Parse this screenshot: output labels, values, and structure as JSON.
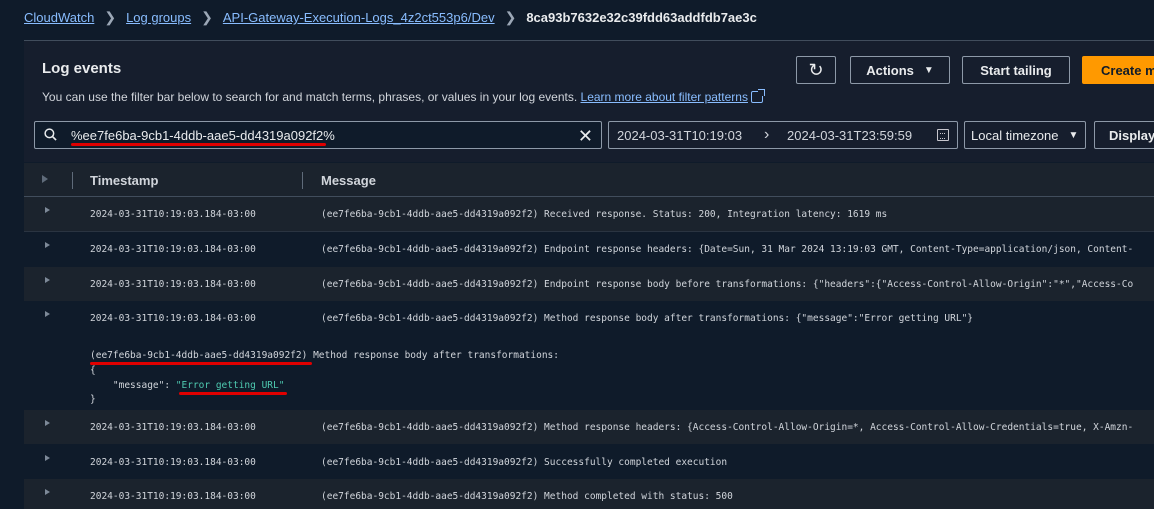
{
  "breadcrumb": {
    "items": [
      "CloudWatch",
      "Log groups",
      "API-Gateway-Execution-Logs_4z2ct553p6/Dev"
    ],
    "current": "8ca93b7632e32c39fdd63addfdb7ae3c"
  },
  "panel": {
    "title": "Log events",
    "description": "You can use the filter bar below to search for and match terms, phrases, or values in your log events.",
    "learn_more": "Learn more about filter patterns"
  },
  "toolbar": {
    "refresh_icon": "refresh-icon",
    "actions_label": "Actions",
    "start_tailing_label": "Start tailing",
    "create_label": "Create m"
  },
  "filter": {
    "value": "%ee7fe6ba-9cb1-4ddb-aae5-dd4319a092f2%",
    "date_from": "2024-03-31T10:19:03",
    "date_to": "2024-03-31T23:59:59",
    "timezone": "Local timezone",
    "display_label": "Display"
  },
  "table": {
    "columns": [
      "Timestamp",
      "Message"
    ],
    "rows": [
      {
        "ts": "2024-03-31T10:19:03.184-03:00",
        "msg": "(ee7fe6ba-9cb1-4ddb-aae5-dd4319a092f2) Received response. Status: 200, Integration latency: 1619 ms"
      },
      {
        "ts": "2024-03-31T10:19:03.184-03:00",
        "msg": "(ee7fe6ba-9cb1-4ddb-aae5-dd4319a092f2) Endpoint response headers: {Date=Sun, 31 Mar 2024 13:19:03 GMT, Content-Type=application/json, Content-"
      },
      {
        "ts": "2024-03-31T10:19:03.184-03:00",
        "msg": "(ee7fe6ba-9cb1-4ddb-aae5-dd4319a092f2) Endpoint response body before transformations: {\"headers\":{\"Access-Control-Allow-Origin\":\"*\",\"Access-Co"
      },
      {
        "ts": "2024-03-31T10:19:03.184-03:00",
        "msg": "(ee7fe6ba-9cb1-4ddb-aae5-dd4319a092f2) Method response body after transformations: {\"message\":\"Error getting URL\"}"
      },
      {
        "ts": "2024-03-31T10:19:03.184-03:00",
        "msg": "(ee7fe6ba-9cb1-4ddb-aae5-dd4319a092f2) Method response headers: {Access-Control-Allow-Origin=*, Access-Control-Allow-Credentials=true, X-Amzn-"
      },
      {
        "ts": "2024-03-31T10:19:03.184-03:00",
        "msg": "(ee7fe6ba-9cb1-4ddb-aae5-dd4319a092f2) Successfully completed execution"
      },
      {
        "ts": "2024-03-31T10:19:03.184-03:00",
        "msg": "(ee7fe6ba-9cb1-4ddb-aae5-dd4319a092f2) Method completed with status: 500"
      }
    ],
    "expanded": {
      "line1_id": "(ee7fe6ba-9cb1-4ddb-aae5-dd4319a092f2)",
      "line1_rest": " Method response body after transformations:",
      "open_brace": "{",
      "key": "    \"message\": ",
      "value": "\"Error getting URL\"",
      "close_brace": "}"
    }
  },
  "colors": {
    "background": "#0f1b2a",
    "link": "#89bdff",
    "primary_button": "#ff9900",
    "annotation_red": "#e00000"
  }
}
